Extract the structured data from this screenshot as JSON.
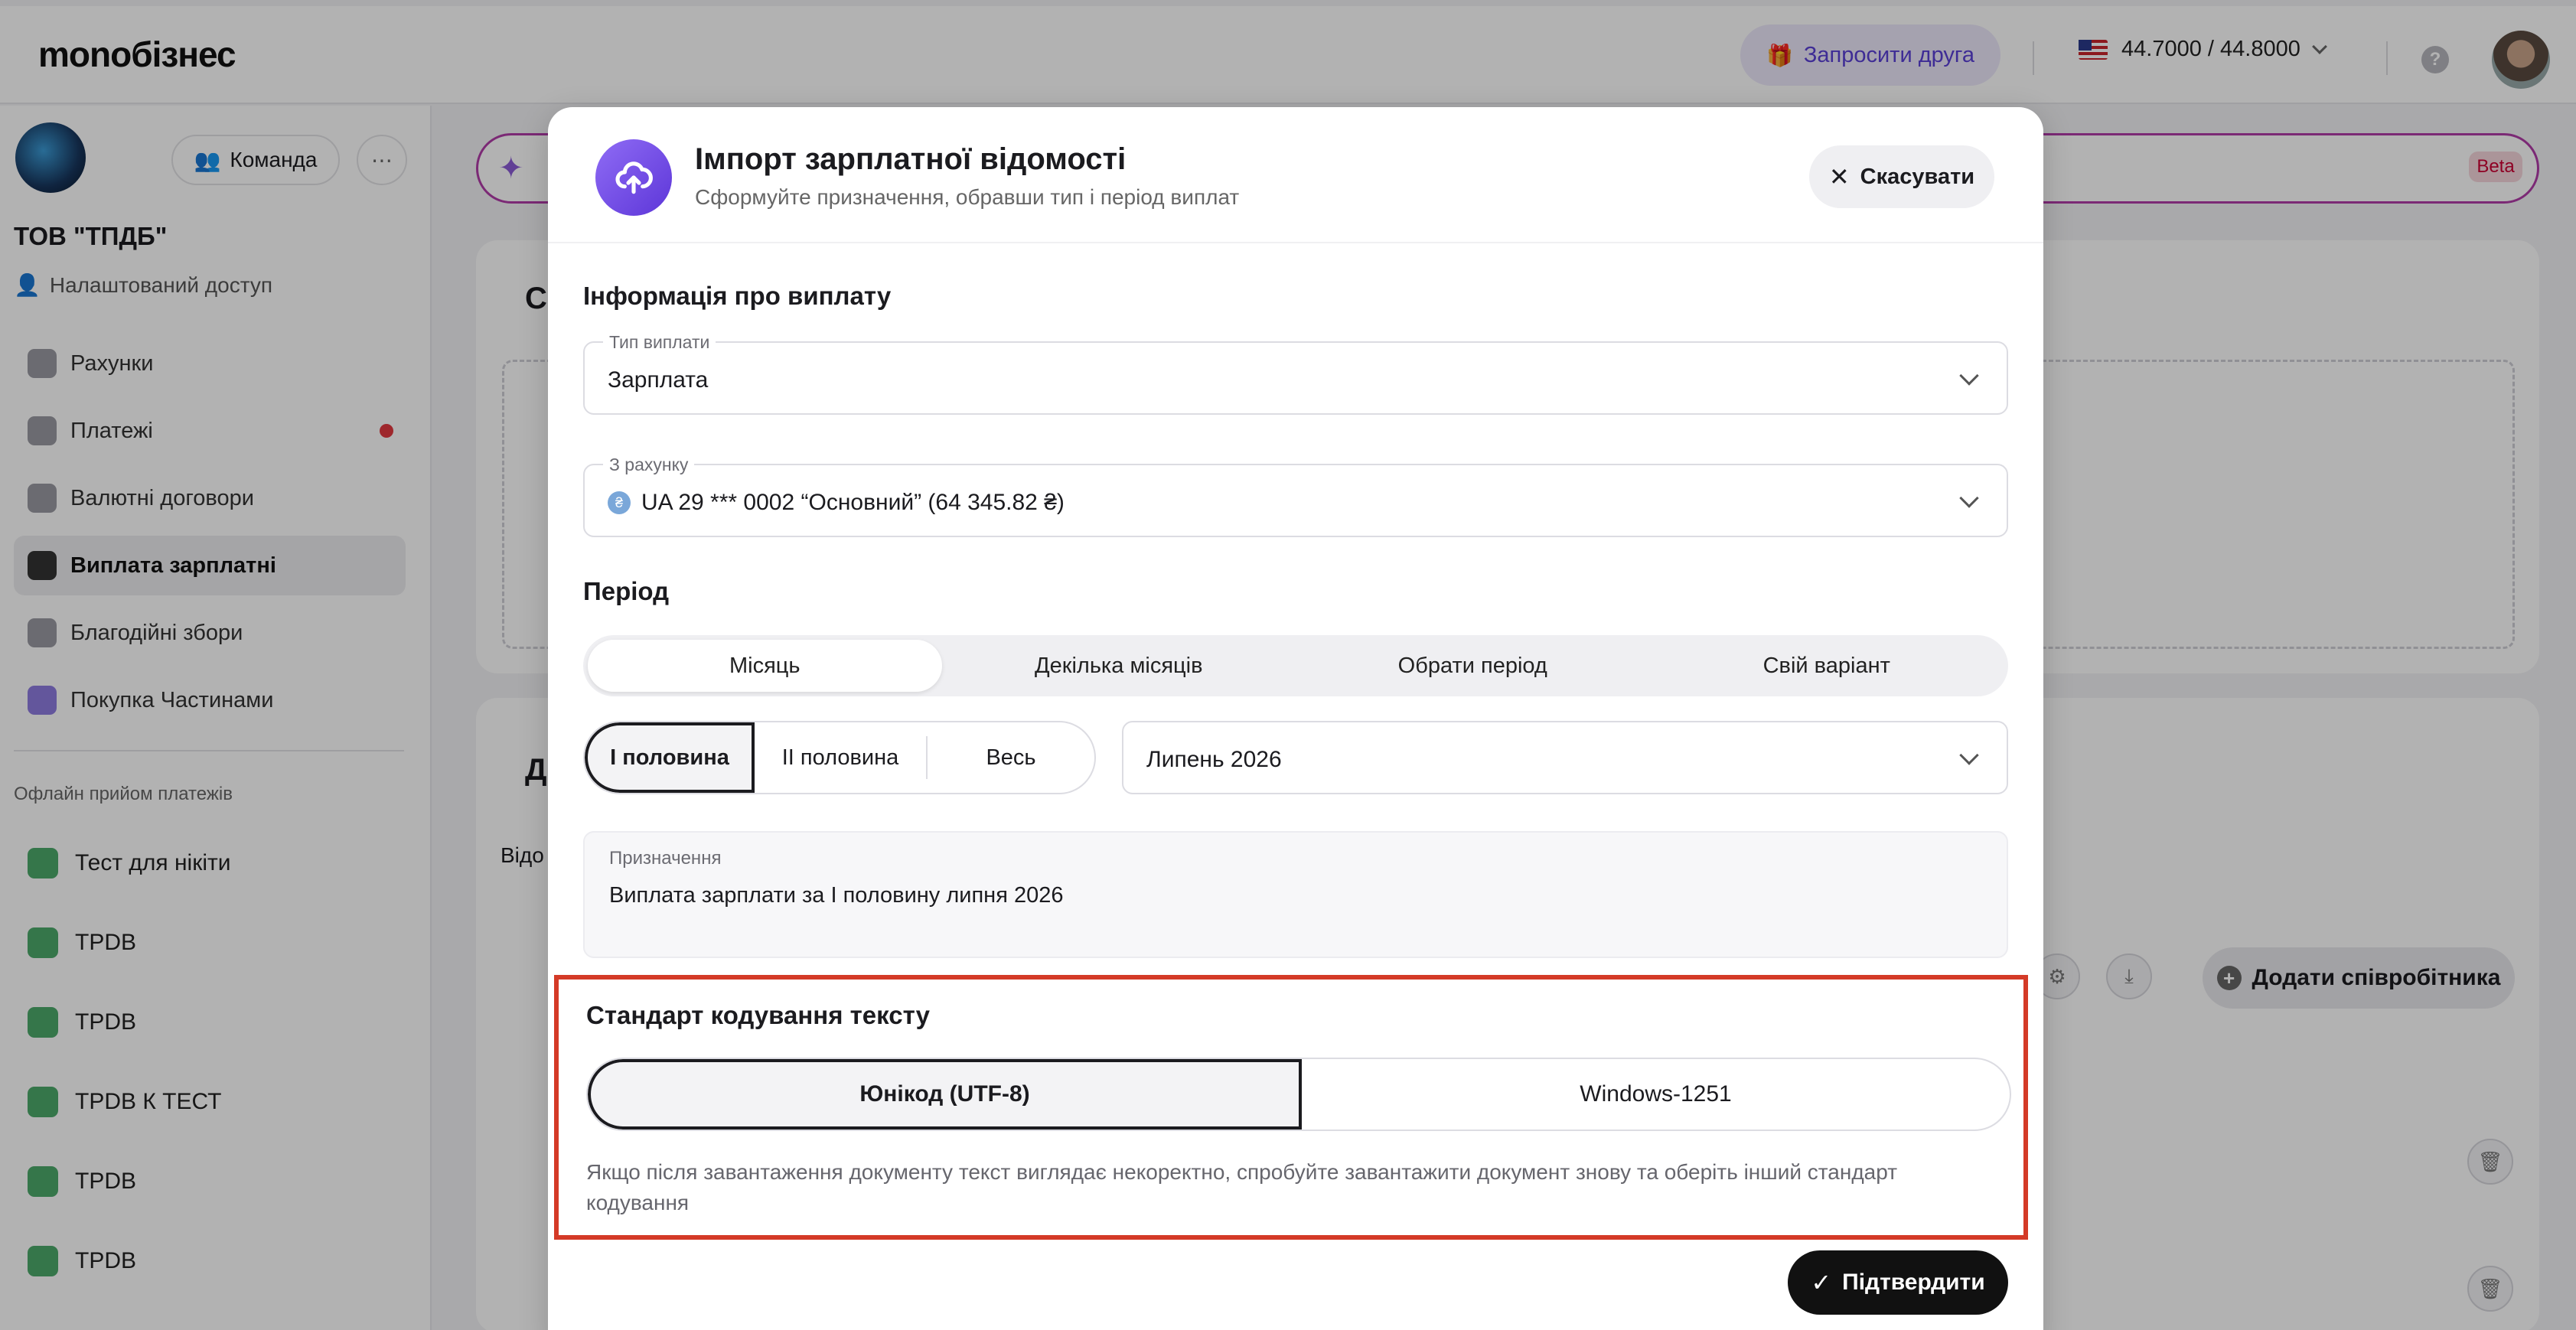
{
  "topbar": {
    "logo": "monoбізнес",
    "invite_label": "Запросити друга",
    "rate": "44.7000 / 44.8000",
    "currency_flag": "us-flag-icon"
  },
  "sidebar": {
    "team_label": "Команда",
    "company": "ТОВ \"ТПДБ\"",
    "access": "Налаштований доступ",
    "items": [
      {
        "label": "Рахунки",
        "icon": "wallet-icon"
      },
      {
        "label": "Платежі",
        "icon": "transfer-icon"
      },
      {
        "label": "Валютні договори",
        "icon": "currency-contract-icon"
      },
      {
        "label": "Виплата зарплатні",
        "icon": "salary-icon"
      },
      {
        "label": "Благодійні збори",
        "icon": "charity-icon"
      },
      {
        "label": "Покупка Частинами",
        "icon": "paw-icon"
      }
    ],
    "offline_title": "Офлайн прийом платежів",
    "offline_items": [
      {
        "label": "Тест для нікіти"
      },
      {
        "label": "TPDB"
      },
      {
        "label": "TPDB"
      },
      {
        "label": "TPDB К ТЕСТ"
      },
      {
        "label": "TPDB"
      },
      {
        "label": "TPDB"
      }
    ]
  },
  "background": {
    "beta": "Beta",
    "card1_letter": "С",
    "card2_letter": "Д",
    "card2_sub": "Відо",
    "add_employee": "Додати співробітника"
  },
  "modal": {
    "title": "Імпорт зарплатної відомості",
    "subtitle": "Сформуйте призначення, обравши тип і період виплат",
    "cancel_label": "Скасувати",
    "payment_info_title": "Інформація про виплату",
    "payment_type": {
      "label": "Тип виплати",
      "value": "Зарплата"
    },
    "from_account": {
      "label": "З рахунку",
      "value": "UA 29 *** 0002 “Основний” (64 345.82 ₴)"
    },
    "period_title": "Період",
    "period_tabs": [
      "Місяць",
      "Декілька місяців",
      "Обрати період",
      "Свій варіант"
    ],
    "half_options": [
      "І половина",
      "ІІ половина",
      "Весь"
    ],
    "month_value": "Липень 2026",
    "purpose": {
      "label": "Призначення",
      "value": "Виплата зарплати за І половину липня 2026"
    },
    "encoding_title": "Стандарт кодування тексту",
    "encoding_options": [
      "Юнікод (UTF-8)",
      "Windows-1251"
    ],
    "encoding_hint": "Якщо після завантаження документу текст виглядає некоректно, спробуйте завантажити документ знову та оберіть інший стандарт кодування",
    "confirm_label": "Підтвердити"
  },
  "colors": {
    "accent_purple": "#5d36d8",
    "highlight_red": "#d43a27",
    "primary_button": "#111111"
  }
}
